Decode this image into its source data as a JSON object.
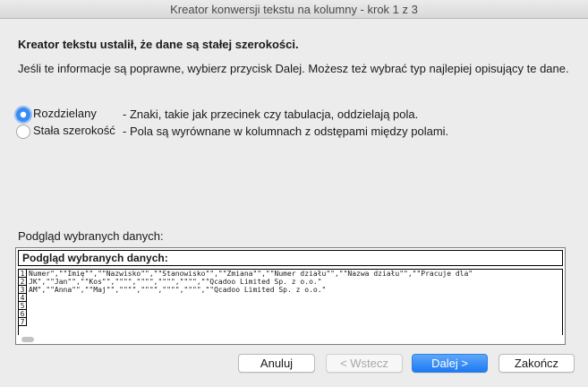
{
  "window": {
    "title": "Kreator konwersji tekstu na kolumny - krok 1 z 3"
  },
  "heading": "Kreator tekstu ustalił, że dane są stałej szerokości.",
  "info": "Jeśli te informacje są poprawne, wybierz przycisk Dalej. Możesz też wybrać typ najlepiej opisujący te dane.",
  "options": [
    {
      "label": "Rozdzielany",
      "description": "- Znaki, takie jak przecinek czy tabulacja, oddzielają pola.",
      "selected": true
    },
    {
      "label": "Stała szerokość",
      "description": "- Pola są wyrównane w kolumnach z odstępami między polami.",
      "selected": false
    }
  ],
  "preview": {
    "label": "Podgląd wybranych danych:",
    "title": "Podgląd wybranych danych:",
    "rows": [
      {
        "num": "1",
        "text": "Numer\",\"\"Imię\"\",\"\"Nazwisko\"\",\"\"Stanowisko\"\",\"\"Zmiana\"\",\"\"Numer działu\"\",\"\"Nazwa działu\"\",\"\"Pracuje dla\""
      },
      {
        "num": "2",
        "text": "JK\",\"\"Jan\"\",\"\"Kos\"\",\"\"\"\",\"\"\"\",\"\"\"\",\"\"\"\",\"\"Qcadoo Limited Sp. z o.o.\""
      },
      {
        "num": "3",
        "text": "AM\",\"\"Anna\"\",\"\"Maj\"\",\"\"\"\",\"\"\"\",\"\"\"\",\"\"\"\",\"\"Qcadoo Limited Sp. z o.o.\""
      },
      {
        "num": "4",
        "text": ""
      },
      {
        "num": "5",
        "text": ""
      },
      {
        "num": "6",
        "text": ""
      },
      {
        "num": "7",
        "text": ""
      }
    ]
  },
  "buttons": {
    "cancel": "Anuluj",
    "back": "< Wstecz",
    "next": "Dalej >",
    "finish": "Zakończ"
  },
  "colors": {
    "accent": "#1d7af3",
    "window_bg": "#ececec"
  }
}
